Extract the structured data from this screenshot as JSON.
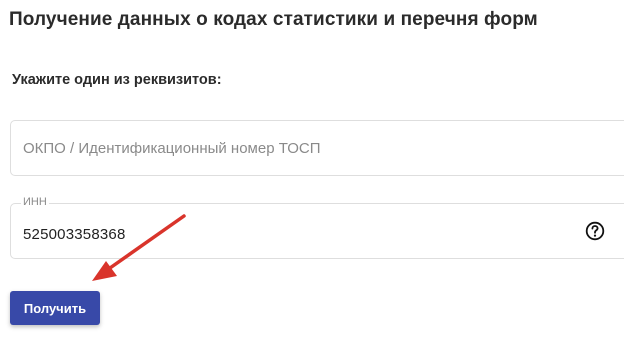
{
  "page": {
    "title": "Получение данных о кодах статистики и перечня форм",
    "section_label": "Укажите один из реквизитов:"
  },
  "form": {
    "okpo_field": {
      "placeholder": "ОКПО / Идентификационный номер ТОСП",
      "value": ""
    },
    "inn_field": {
      "label": "ИНН",
      "value": "525003358368",
      "help_icon": "question-circle-icon"
    },
    "submit_label": "Получить"
  },
  "annotation": {
    "arrow_color": "#d9342b",
    "arrow_icon": "red-arrow-pointing-to-submit"
  },
  "colors": {
    "primary_button": "#3849a8",
    "border": "#dedede",
    "placeholder": "#8a8a8a"
  }
}
